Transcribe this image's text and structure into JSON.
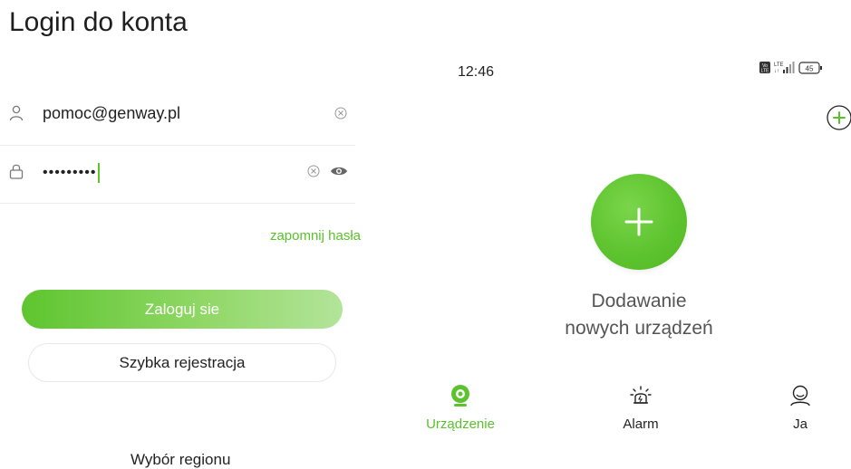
{
  "login": {
    "title": "Login do konta",
    "email_value": "pomoc@genway.pl",
    "password_masked": "•••••••••",
    "forgot_password": "zapomnij hasła",
    "login_button": "Zaloguj sie",
    "register_button": "Szybka rejestracja",
    "region_select": "Wybór regionu"
  },
  "phone": {
    "status_bar": {
      "time": "12:46",
      "network": "LTE",
      "volte": "Vo LTE",
      "battery": "45"
    },
    "empty_state": {
      "line1": "Dodawanie",
      "line2": "nowych urządzeń"
    },
    "nav": [
      {
        "label": "Urządzenie",
        "icon": "camera-icon",
        "active": true
      },
      {
        "label": "Alarm",
        "icon": "alarm-siren-icon",
        "active": false
      },
      {
        "label": "Ja",
        "icon": "profile-icon",
        "active": false
      }
    ]
  },
  "colors": {
    "accent": "#59c22b",
    "accent_light": "#b3e49a",
    "divider": "#eeeeee"
  }
}
